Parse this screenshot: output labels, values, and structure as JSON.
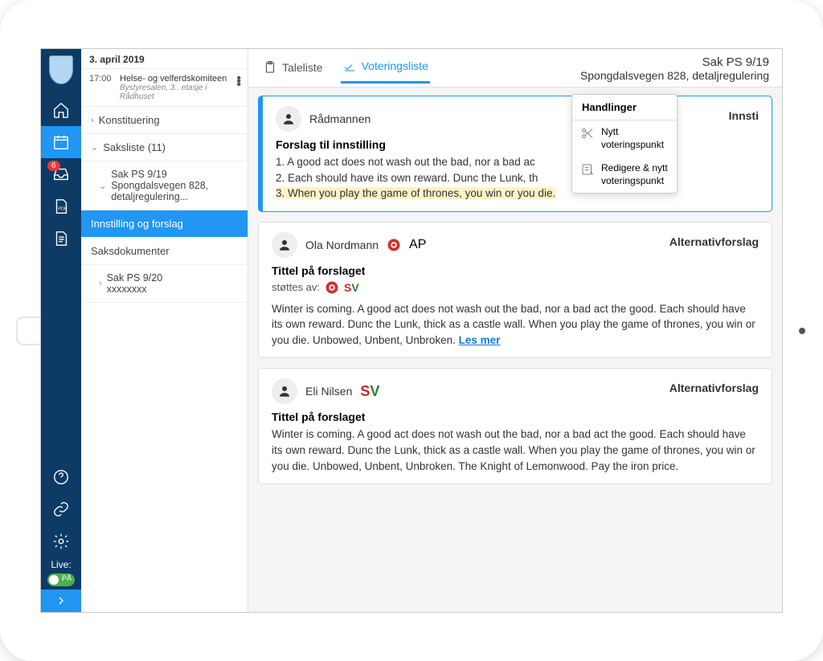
{
  "sidebar": {
    "date": "3. april 2019",
    "meeting": {
      "time": "17:00",
      "title": "Helse- og velferdskomiteen",
      "location": "Bystyresalen, 3.. etasje i Rådhuset"
    },
    "items": {
      "konst": "Konstituering",
      "saksliste": "Saksliste (11)",
      "sak919": "Sak PS 9/19 Spongdalsvegen 828, detaljregulering...",
      "innstilling": "Innstilling og forslag",
      "saksdok": "Saksdokumenter",
      "sak920_line1": "Sak PS 9/20",
      "sak920_line2": "xxxxxxxx"
    }
  },
  "nav": {
    "badge": "6",
    "live_label": "Live:",
    "toggle_text": "PÅ"
  },
  "header": {
    "tab_taleliste": "Taleliste",
    "tab_voteringsliste": "Voteringsliste",
    "case_line1": "Sak PS 9/19",
    "case_line2": "Spongdalsvegen 828, detaljregulering"
  },
  "dropdown": {
    "title": "Handlinger",
    "item1": "Nytt voteringspunkt",
    "item2": "Redigere & nytt voteringspunkt"
  },
  "cards": {
    "c1": {
      "author": "Rådmannen",
      "type": "Innsti",
      "title": "Forslag til innstilling",
      "l1": "1. A good act does not wash out the bad, nor a bad ac",
      "l2": "2. Each should have its own reward. Dunc the Lunk, th",
      "l3": "3. When you play the game of thrones, you win or you die."
    },
    "c2": {
      "author": "Ola Nordmann",
      "party": "AP",
      "type": "Alternativforslag",
      "title": "Tittel på forslaget",
      "supports_label": "støttes av:",
      "body": "Winter is coming. A good act does not wash out the bad, nor a bad act the good. Each should have its own reward. Dunc the Lunk, thick as a castle wall. When you play the game of thrones, you win or you die. Unbowed, Unbent, Unbroken.  ",
      "read_more": "Les mer"
    },
    "c3": {
      "author": "Eli Nilsen",
      "type": "Alternativforslag",
      "title": "Tittel på forslaget",
      "body": "Winter is coming. A good act does not wash out the bad, nor a bad act the good. Each should have its own reward. Dunc the Lunk, thick as a castle wall. When you play the game of thrones, you win or you die. Unbowed, Unbent, Unbroken. The Knight of Lemonwood. Pay the iron price."
    }
  }
}
